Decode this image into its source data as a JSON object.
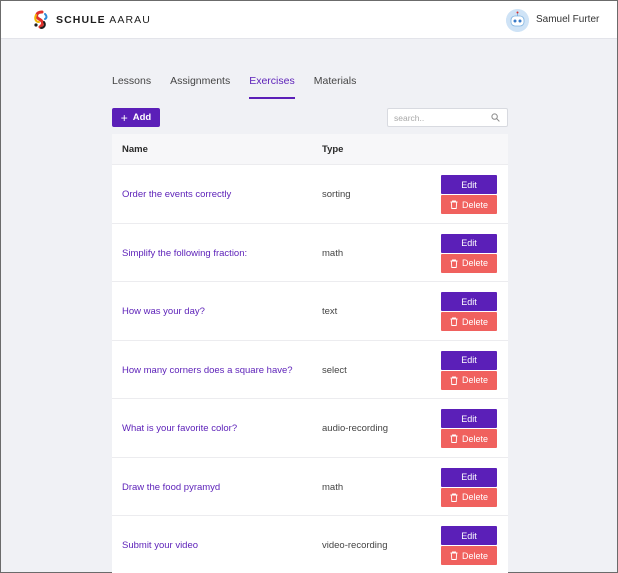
{
  "brand": {
    "name_bold": "SCHULE",
    "name_light": "AARAU"
  },
  "user": {
    "name": "Samuel Furter"
  },
  "tabs": [
    {
      "label": "Lessons",
      "active": false
    },
    {
      "label": "Assignments",
      "active": false
    },
    {
      "label": "Exercises",
      "active": true
    },
    {
      "label": "Materials",
      "active": false
    }
  ],
  "toolbar": {
    "add_label": "Add",
    "search_placeholder": "search.."
  },
  "table": {
    "headers": {
      "name": "Name",
      "type": "Type"
    },
    "rows": [
      {
        "name": "Order the events correctly",
        "type": "sorting"
      },
      {
        "name": "Simplify the following fraction:",
        "type": "math"
      },
      {
        "name": "How was your day?",
        "type": "text"
      },
      {
        "name": "How many corners does a square have?",
        "type": "select"
      },
      {
        "name": "What is your favorite color?",
        "type": "audio-recording"
      },
      {
        "name": "Draw the food pyramyd",
        "type": "math"
      },
      {
        "name": "Submit your video",
        "type": "video-recording"
      }
    ],
    "edit_label": "Edit",
    "delete_label": "Delete"
  },
  "colors": {
    "accent": "#5b1fb8",
    "danger": "#f0615e",
    "background": "#f0f1f5"
  }
}
